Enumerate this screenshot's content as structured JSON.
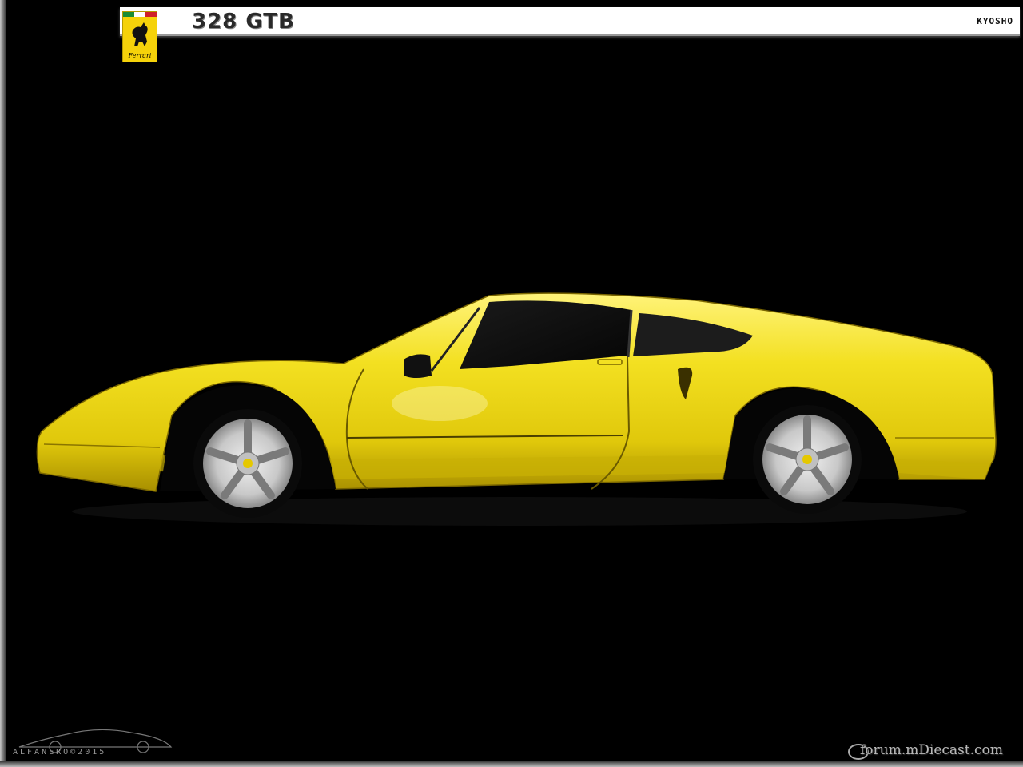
{
  "header": {
    "model": "328 GTB",
    "maker": "KYOSHO",
    "badge_word": "Ferrari"
  },
  "footer": {
    "signature": "ALFANERO©2015",
    "watermark": "forum.mDiecast.com"
  },
  "colors": {
    "car_body": "#f2dc1a",
    "background": "#000000",
    "badge": "#f5d20a"
  }
}
